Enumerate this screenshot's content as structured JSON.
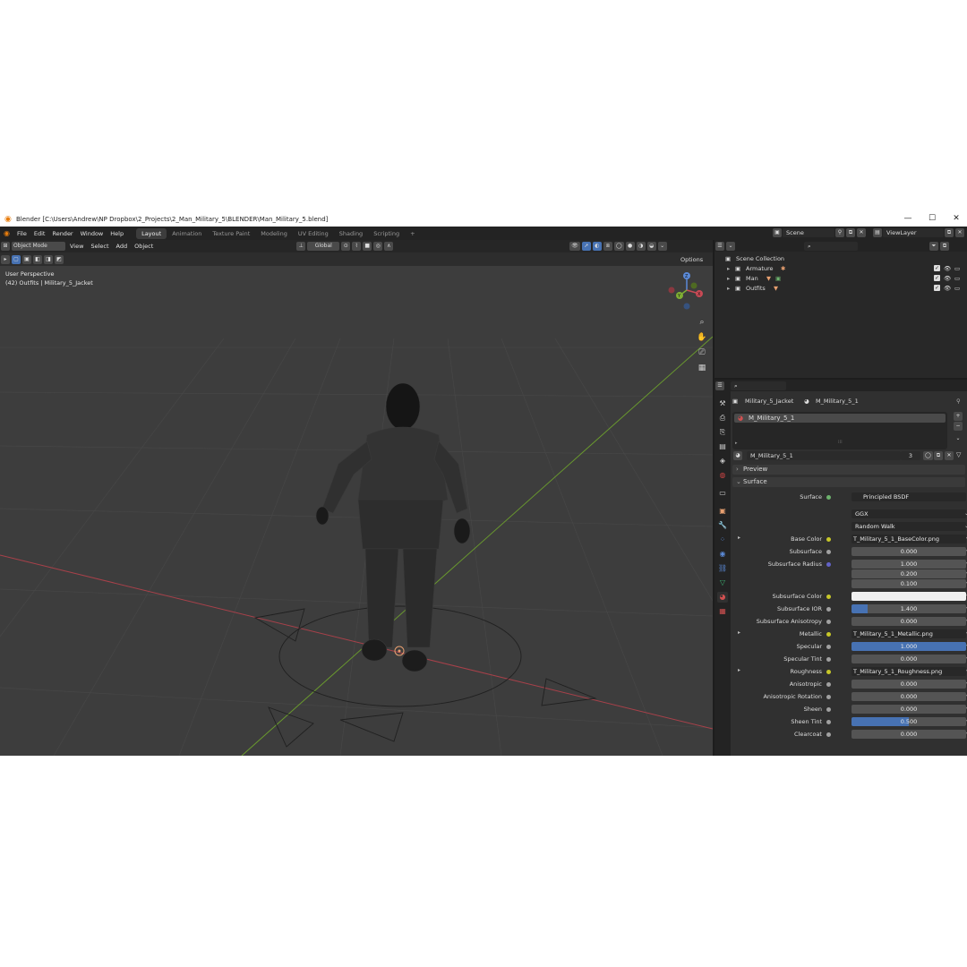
{
  "titlebar": {
    "title": "Blender [C:\\Users\\Andrew\\NP Dropbox\\2_Projects\\2_Man_Military_5\\BLENDER\\Man_Military_5.blend]",
    "minimize": "—",
    "maximize": "☐",
    "close": "✕"
  },
  "menu": [
    "File",
    "Edit",
    "Render",
    "Window",
    "Help"
  ],
  "workspaces": [
    "Layout",
    "Animation",
    "Texture Paint",
    "Modeling",
    "UV Editing",
    "Shading",
    "Scripting"
  ],
  "add_workspace": "+",
  "scene": {
    "value": "Scene"
  },
  "view_layer": {
    "value": "ViewLayer"
  },
  "viewport": {
    "mode": "Object Mode",
    "menus": [
      "View",
      "Select",
      "Add",
      "Object"
    ],
    "transform": "Global",
    "options": "Options",
    "view_name": "User Perspective",
    "object_info": "(42) Outfits | Military_5_Jacket",
    "gizmo": {
      "x": "X",
      "y": "Y",
      "z": "Z"
    },
    "colors": {
      "bg": "#3d3d3d",
      "grid": "#4a4a4a",
      "x_axis": "#a8414a",
      "y_axis": "#6a9a2e"
    }
  },
  "outliner": {
    "root": "Scene Collection",
    "items": [
      {
        "name": "Armature"
      },
      {
        "name": "Man"
      },
      {
        "name": "Outfits"
      }
    ]
  },
  "properties": {
    "breadcrumb": {
      "object": "Military_5_Jacket",
      "material": "M_Military_5_1"
    },
    "slot": "M_Military_5_1",
    "material_name": "M_Military_5_1",
    "users": "3",
    "panels": {
      "preview": "Preview",
      "surface": "Surface"
    },
    "surface": {
      "label": "Surface",
      "value": "Principled BSDF"
    },
    "distribution": "GGX",
    "subsurface_method": "Random Walk",
    "rows": [
      {
        "label": "Base Color",
        "value": "T_Military_5_1_BaseColor.png",
        "kind": "texture"
      },
      {
        "label": "Subsurface",
        "value": "0.000",
        "kind": "num"
      },
      {
        "label": "Subsurface Radius",
        "value": "1.000",
        "kind": "vec"
      },
      {
        "label": "",
        "value": "0.200",
        "kind": "vec2"
      },
      {
        "label": "",
        "value": "0.100",
        "kind": "vec2"
      },
      {
        "label": "Subsurface Color",
        "value": "",
        "kind": "color"
      },
      {
        "label": "Subsurface IOR",
        "value": "1.400",
        "kind": "numpart"
      },
      {
        "label": "Subsurface Anisotropy",
        "value": "0.000",
        "kind": "num"
      },
      {
        "label": "Metallic",
        "value": "T_Military_5_1_Metallic.png",
        "kind": "texture"
      },
      {
        "label": "Specular",
        "value": "1.000",
        "kind": "numfull"
      },
      {
        "label": "Specular Tint",
        "value": "0.000",
        "kind": "num"
      },
      {
        "label": "Roughness",
        "value": "T_Military_5_1_Roughness.png",
        "kind": "texture"
      },
      {
        "label": "Anisotropic",
        "value": "0.000",
        "kind": "num"
      },
      {
        "label": "Anisotropic Rotation",
        "value": "0.000",
        "kind": "num"
      },
      {
        "label": "Sheen",
        "value": "0.000",
        "kind": "num"
      },
      {
        "label": "Sheen Tint",
        "value": "0.500",
        "kind": "numhalf"
      },
      {
        "label": "Clearcoat",
        "value": "0.000",
        "kind": "num"
      }
    ]
  }
}
